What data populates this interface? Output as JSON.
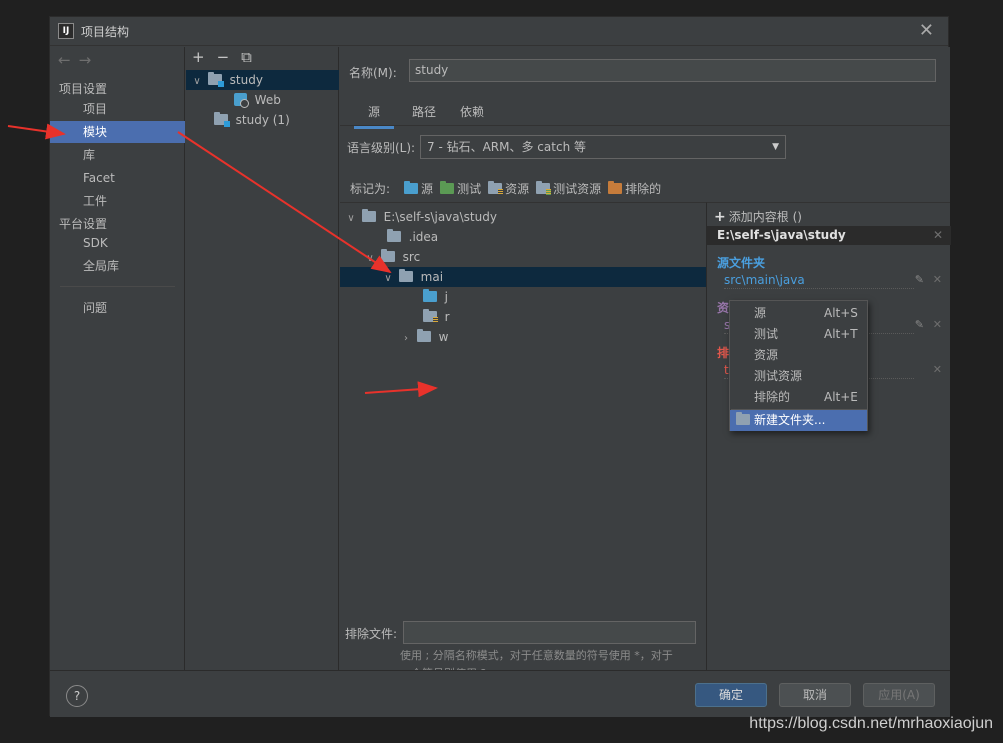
{
  "window": {
    "title": "项目结构"
  },
  "nav": {
    "back": "←",
    "forward": "→",
    "heading_project": "项目设置",
    "items": [
      {
        "label": "项目"
      },
      {
        "label": "模块"
      },
      {
        "label": "库"
      },
      {
        "label": "Facet"
      },
      {
        "label": "工件"
      }
    ],
    "heading_platform": "平台设置",
    "platform_items": [
      {
        "label": "SDK"
      },
      {
        "label": "全局库"
      }
    ],
    "problems": "问题"
  },
  "modules": {
    "toolbar": {
      "add": "+",
      "remove": "−",
      "copy": "⧉"
    },
    "rows": [
      {
        "label": "study"
      },
      {
        "label": "Web"
      },
      {
        "label": "study (1)"
      }
    ]
  },
  "main": {
    "name_label": "名称(M):",
    "name_value": "study",
    "tabs": [
      {
        "label": "源"
      },
      {
        "label": "路径"
      },
      {
        "label": "依赖"
      }
    ],
    "lang_label": "语言级别(L):",
    "lang_value": "7 - 钻石、ARM、多 catch 等",
    "mark_label": "标记为:",
    "marks": [
      {
        "label": "源"
      },
      {
        "label": "测试"
      },
      {
        "label": "资源"
      },
      {
        "label": "测试资源"
      },
      {
        "label": "排除的"
      }
    ],
    "tree": [
      {
        "label": "E:\\self-s\\java\\study"
      },
      {
        "label": ".idea"
      },
      {
        "label": "src"
      },
      {
        "label": "mai"
      },
      {
        "label": "j"
      },
      {
        "label": "r"
      },
      {
        "label": "w"
      }
    ],
    "exclude_label": "排除文件:",
    "hint_line1": "使用 ; 分隔名称模式，对于任意数量的符号使用 *，对于",
    "hint_line2": "一个符号则使用 ?。"
  },
  "context_menu": {
    "items": [
      {
        "label": "源",
        "shortcut": "Alt+S"
      },
      {
        "label": "测试",
        "shortcut": "Alt+T"
      },
      {
        "label": "资源",
        "shortcut": ""
      },
      {
        "label": "测试资源",
        "shortcut": ""
      },
      {
        "label": "排除的",
        "shortcut": "Alt+E"
      },
      {
        "label": "新建文件夹...",
        "shortcut": ""
      }
    ]
  },
  "roots": {
    "add_label": "添加内容根",
    "add_suffix": "()",
    "root_path": "E:\\self-s\\java\\study",
    "source_title": "源文件夹",
    "source_path": "src\\main\\java",
    "resource_title": "资源文件夹",
    "resource_path": "src\\main\\resources",
    "excluded_title": "排除的文件夹",
    "excluded_path": "target",
    "colors": {
      "source": "#4a9fdf",
      "resource": "#9876aa",
      "excluded": "#e0574c"
    }
  },
  "footer": {
    "help": "?",
    "ok": "确定",
    "cancel": "取消",
    "apply": "应用(A)"
  },
  "watermark": "https://blog.csdn.net/mrhaoxiaojun"
}
